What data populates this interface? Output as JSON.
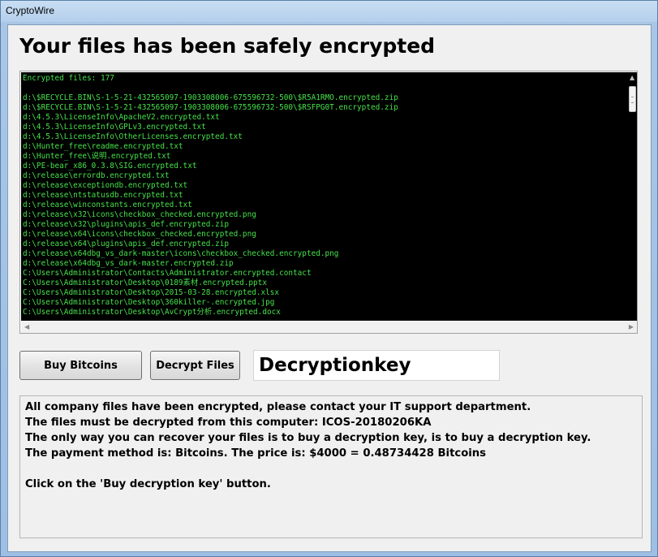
{
  "window": {
    "title": "CryptoWire"
  },
  "heading": "Your files has been safely encrypted",
  "log": {
    "header": "Encrypted files: 177",
    "lines": [
      "",
      "d:\\$RECYCLE.BIN\\S-1-5-21-432565097-1903308006-675596732-500\\$R5A1RMO.encrypted.zip",
      "d:\\$RECYCLE.BIN\\S-1-5-21-432565097-1903308006-675596732-500\\$RSFPG0T.encrypted.zip",
      "d:\\4.5.3\\LicenseInfo\\ApacheV2.encrypted.txt",
      "d:\\4.5.3\\LicenseInfo\\GPLv3.encrypted.txt",
      "d:\\4.5.3\\LicenseInfo\\OtherLicenses.encrypted.txt",
      "d:\\Hunter_free\\readme.encrypted.txt",
      "d:\\Hunter_free\\说明.encrypted.txt",
      "d:\\PE-bear_x86_0.3.8\\SIG.encrypted.txt",
      "d:\\release\\errordb.encrypted.txt",
      "d:\\release\\exceptiondb.encrypted.txt",
      "d:\\release\\ntstatusdb.encrypted.txt",
      "d:\\release\\winconstants.encrypted.txt",
      "d:\\release\\x32\\icons\\checkbox_checked.encrypted.png",
      "d:\\release\\x32\\plugins\\apis_def.encrypted.zip",
      "d:\\release\\x64\\icons\\checkbox_checked.encrypted.png",
      "d:\\release\\x64\\plugins\\apis_def.encrypted.zip",
      "d:\\release\\x64dbg_vs_dark-master\\icons\\checkbox_checked.encrypted.png",
      "d:\\release\\x64dbg_vs_dark-master.encrypted.zip",
      "C:\\Users\\Administrator\\Contacts\\Administrator.encrypted.contact",
      "C:\\Users\\Administrator\\Desktop\\0189素材.encrypted.pptx",
      "C:\\Users\\Administrator\\Desktop\\2015-03-28.encrypted.xlsx",
      "C:\\Users\\Administrator\\Desktop\\360killer-.encrypted.jpg",
      "C:\\Users\\Administrator\\Desktop\\AvCrypt分析.encrypted.docx"
    ]
  },
  "buttons": {
    "buy": "Buy Bitcoins",
    "decrypt": "Decrypt Files"
  },
  "key_input": {
    "value": "Decryptionkey"
  },
  "info": {
    "lines": [
      "All company files have been encrypted, please contact your IT support department.",
      "The files must be decrypted from this computer: ICOS-20180206KA",
      "The only way you can recover your files is to buy a decryption key, is to buy a decryption key.",
      "The payment method is: Bitcoins.  The price is: $4000 = 0.48734428 Bitcoins",
      "",
      "Click on the 'Buy decryption key' button."
    ]
  },
  "icons": {
    "scroll_up": "triangle-up",
    "scroll_left": "triangle-left",
    "scroll_right": "triangle-right"
  },
  "colors": {
    "log_text": "#46e24a",
    "log_background": "#000000"
  }
}
